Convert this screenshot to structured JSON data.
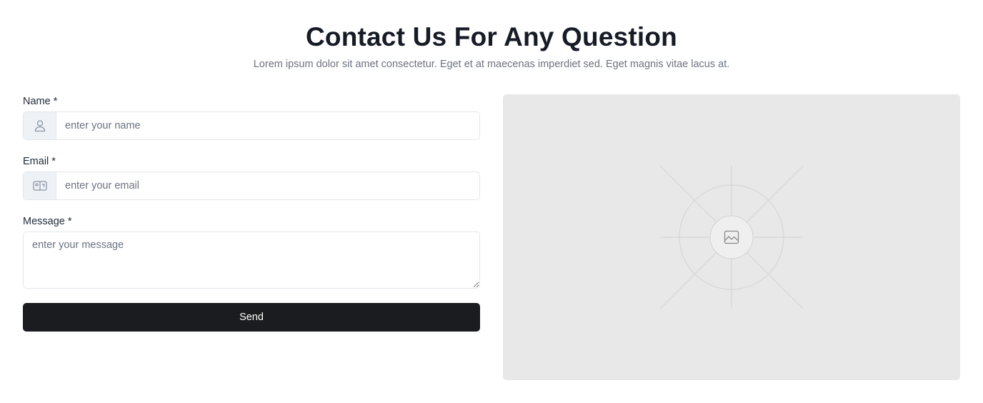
{
  "header": {
    "title": "Contact Us For Any Question",
    "subtitle": "Lorem ipsum dolor sit amet consectetur. Eget et at maecenas imperdiet sed. Eget magnis vitae lacus at."
  },
  "form": {
    "name": {
      "label": "Name *",
      "placeholder": "enter your name",
      "value": "",
      "icon": "user-icon"
    },
    "email": {
      "label": "Email *",
      "placeholder": "enter your email",
      "value": "",
      "icon": "id-card-icon"
    },
    "message": {
      "label": "Message *",
      "placeholder": "enter your message",
      "value": ""
    },
    "submit_label": "Send"
  },
  "media": {
    "icon": "image-placeholder-icon"
  },
  "colors": {
    "primary_button": "#1b1c1f",
    "addon_background": "#eef2f7",
    "placeholder_panel": "#e8e8e8",
    "heading": "#161b26",
    "muted_text": "#6b7280"
  }
}
